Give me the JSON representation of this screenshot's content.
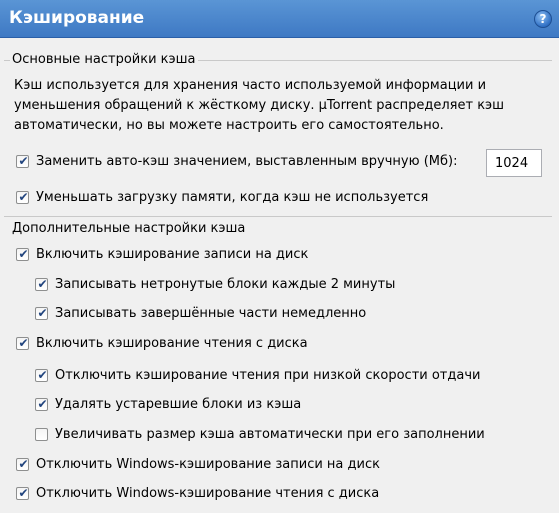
{
  "header": {
    "title": "Кэширование",
    "help_symbol": "?",
    "background_color": "#4a87cc"
  },
  "basic": {
    "legend": "Основные настройки кэша",
    "description": "Кэш используется для хранения часто используемой информации и уменьшения обращений к жёсткому диску. µTorrent распределяет кэш автоматически, но вы можете настроить его самостоятельно.",
    "override": {
      "label": "Заменить авто-кэш значением, выставленным вручную (Мб):",
      "checked": true
    },
    "cache_size_value": "1024",
    "reduce_memory": {
      "label": "Уменьшать загрузку памяти, когда кэш не используется",
      "checked": true
    }
  },
  "advanced": {
    "legend": "Дополнительные настройки кэша",
    "enable_write_cache": {
      "label": "Включить кэширование записи на диск",
      "checked": true
    },
    "write_untouched": {
      "label": "Записывать нетронутые блоки каждые 2 минуты",
      "checked": true
    },
    "write_finished": {
      "label": "Записывать завершённые части немедленно",
      "checked": true
    },
    "enable_read_cache": {
      "label": "Включить кэширование чтения с диска",
      "checked": true
    },
    "disable_read_low_speed": {
      "label": "Отключить кэширование чтения при низкой скорости отдачи",
      "checked": true
    },
    "remove_old_blocks": {
      "label": "Удалять устаревшие блоки из кэша",
      "checked": true
    },
    "auto_increase": {
      "label": "Увеличивать размер кэша автоматически при его заполнении",
      "checked": false
    },
    "disable_windows_write": {
      "label": "Отключить Windows-кэширование записи на диск",
      "checked": true
    },
    "disable_windows_read": {
      "label": "Отключить Windows-кэширование чтения с диска",
      "checked": true
    }
  },
  "check_glyph": "✔"
}
